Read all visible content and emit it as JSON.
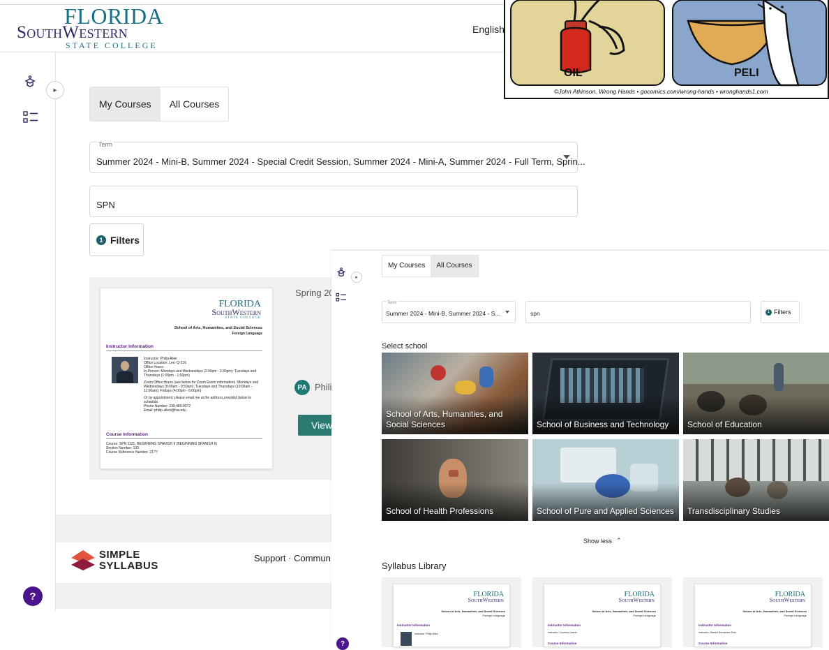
{
  "header": {
    "logo_line1": "FLORIDA",
    "logo_line2": "SouthWestern",
    "logo_line3": "STATE COLLEGE",
    "language": "English"
  },
  "sidebar": {
    "icons": [
      "course-icon",
      "list-icon"
    ],
    "collapse_icon": "chevron-right-icon"
  },
  "tabs": [
    "My Courses",
    "All Courses"
  ],
  "term": {
    "label": "Term",
    "value": "Summer 2024 - Mini-B, Summer 2024 - Special Credit Session, Summer 2024 - Mini-A, Summer 2024 - Full Term, Sprin..."
  },
  "search": {
    "value": "SPN"
  },
  "filters": {
    "count": "1",
    "label": "Filters"
  },
  "course_card": {
    "term_text": "Spring 202",
    "instructor_initials": "PA",
    "instructor_name": "Phili",
    "view_label": "View",
    "syllabus": {
      "logo_l1": "FLORIDA",
      "logo_l2": "SouthWestern",
      "logo_l3": "STATE COLLEGE",
      "school": "School of Arts, Humanities, and Social Sciences",
      "dept": "Foreign Language",
      "section1": "Instructor Information",
      "instructor_line": "Instructor: Philip Allen",
      "office_location": "Office Location: Lee: Q-216",
      "office_hours": "Office Hours:",
      "in_person": "In-Person: Mondays and Wednesdays (2:30pm - 3:30pm); Tuesdays and Thursdays (1:00pm - 1:50pm)",
      "zoom": "Zoom Office Hours (see below for Zoom Room information): Mondays and Wednesdays (8:00am - 9:50am); Tuesdays and Thursdays (10:00am - 11:00am); Fridays (4:00pm - 6:00pm)",
      "appointment": "Or by appointment; please email me at the address provided below to schedule.",
      "phone": "Phone Number: 239.489.9072",
      "email": "Email: philip.allen@fsw.edu",
      "section2": "Course Information",
      "course_line": "Course: SPN 1121, BEGINNING SPANISH II (BEGINNING SPANISH II)",
      "section_number": "Section Number: 133",
      "reference_number": "Course Reference Number: 21??"
    }
  },
  "footer": {
    "brand_line1": "SIMPLE",
    "brand_line2": "SYLLABUS",
    "links": "Support · Commun",
    "help_label": "?"
  },
  "comic": {
    "left_label": "OIL",
    "right_label": "PELI",
    "credit": "©John Atkinson, Wrong Hands • gocomics.com/wrong-hands • wronghands1.com"
  },
  "overlay": {
    "tabs": [
      "My Courses",
      "All Courses"
    ],
    "term_label": "Term",
    "term_value": "Summer 2024 - Mini-B, Summer 2024 - S...",
    "search_value": "spn",
    "filters_count": "1",
    "filters_label": "Filters",
    "select_school_heading": "Select school",
    "schools": [
      {
        "label": "School of Arts, Humanities, and Social Sciences"
      },
      {
        "label": "School of Business and Technology"
      },
      {
        "label": "School of Education"
      },
      {
        "label": "School of Health Professions"
      },
      {
        "label": "School of Pure and Applied Sciences"
      },
      {
        "label": "Transdisciplinary Studies"
      }
    ],
    "show_less": "Show less",
    "library_heading": "Syllabus Library",
    "library_cards": [
      {
        "section": "Instructor Information",
        "line": "Instructor: Philip Allen"
      },
      {
        "section": "Instructor Information",
        "line": "Instructor: Courtney Lavoie"
      },
      {
        "section": "Instructor Information",
        "line": "Instructor: Marisol Hernandez Soto"
      }
    ],
    "help_label": "?"
  },
  "colors": {
    "teal": "#1b6f82",
    "navy": "#2f2a62",
    "button": "#2a7a71",
    "help": "#4a148c",
    "section_purple": "#5a1b7a"
  }
}
